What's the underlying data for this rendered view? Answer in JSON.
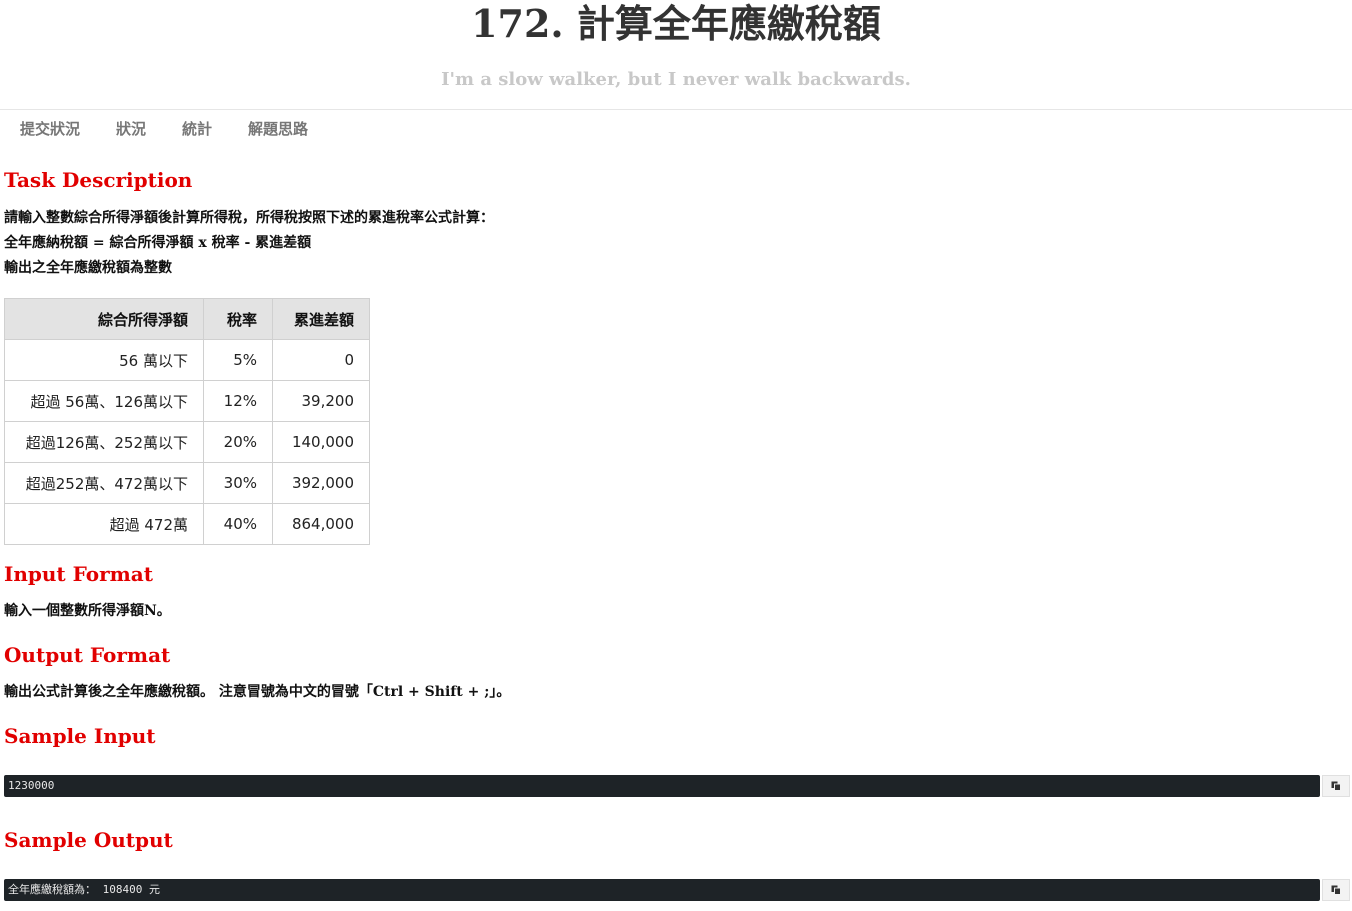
{
  "header": {
    "title": "172. 計算全年應繳稅額",
    "subtitle": "I'm a slow walker, but I never walk backwards."
  },
  "nav": {
    "items": [
      "提交狀況",
      "狀況",
      "統計",
      "解題思路"
    ]
  },
  "task": {
    "heading": "Task Description",
    "lines": [
      "請輸入整數綜合所得淨額後計算所得稅，所得稅按照下述的累進稅率公式計算：",
      "全年應納稅額 = 綜合所得淨額 x 稅率 - 累進差額",
      "輸出之全年應繳稅額為整數"
    ],
    "table": {
      "headers": [
        "綜合所得淨額",
        "稅率",
        "累進差額"
      ],
      "rows": [
        [
          "56 萬以下",
          "5%",
          "0"
        ],
        [
          "超過 56萬、126萬以下",
          "12%",
          "39,200"
        ],
        [
          "超過126萬、252萬以下",
          "20%",
          "140,000"
        ],
        [
          "超過252萬、472萬以下",
          "30%",
          "392,000"
        ],
        [
          "超過 472萬",
          "40%",
          "864,000"
        ]
      ]
    }
  },
  "input_format": {
    "heading": "Input Format",
    "text": "輸入一個整數所得淨額N。"
  },
  "output_format": {
    "heading": "Output Format",
    "text": "輸出公式計算後之全年應繳稅額。 注意冒號為中文的冒號「Ctrl + Shift + ;」。"
  },
  "sample_input": {
    "heading": "Sample Input",
    "code": "1230000"
  },
  "sample_output": {
    "heading": "Sample Output",
    "code": "全年應繳稅額為： 108400 元"
  },
  "icons": {
    "copy": "copy-icon"
  }
}
